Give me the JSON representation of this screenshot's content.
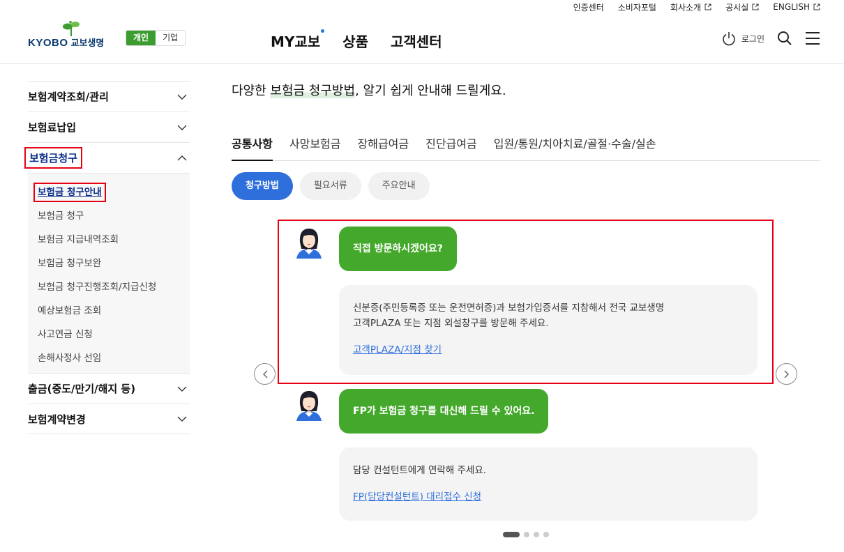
{
  "util_links": [
    {
      "label": "인증센터",
      "external": false
    },
    {
      "label": "소비자포털",
      "external": false
    },
    {
      "label": "회사소개",
      "external": true
    },
    {
      "label": "공시실",
      "external": true
    },
    {
      "label": "ENGLISH",
      "external": true
    }
  ],
  "brand": {
    "logo_en": "KYOBO",
    "logo_kr": "교보생명",
    "accent": "#3c9c30"
  },
  "segment": {
    "personal": "개인",
    "corporate": "기업",
    "selected": "개인"
  },
  "gnb": [
    "MY교보",
    "상품",
    "고객센터"
  ],
  "header_right": {
    "login": "로그인"
  },
  "sidebar": {
    "items": [
      {
        "label": "보험계약조회/관리",
        "expanded": false
      },
      {
        "label": "보험료납입",
        "expanded": false
      },
      {
        "label": "보험금청구",
        "expanded": true
      },
      {
        "label": "출금(중도/만기/해지 등)",
        "expanded": false
      },
      {
        "label": "보험계약변경",
        "expanded": false
      }
    ],
    "sub_items": [
      "보험금 청구안내",
      "보험금 청구",
      "보험금 지급내역조회",
      "보험금 청구보완",
      "보험금 청구진행조회/지급신청",
      "예상보험금 조회",
      "사고연금 신청",
      "손해사정사 선임"
    ]
  },
  "main": {
    "subtitle_pre": "다양한 ",
    "subtitle_hl": "보험금 청구방법",
    "subtitle_post": ", 알기 쉽게 안내해 드릴게요.",
    "tabs": [
      "공통사항",
      "사망보험금",
      "장해급여금",
      "진단급여금",
      "입원/통원/치아치료/골절·수술/실손"
    ],
    "pills": [
      "청구방법",
      "필요서류",
      "주요안내"
    ],
    "cards": [
      {
        "question": "직접 방문하시겠어요?",
        "answer_line1": "신분증(주민등록증 또는 운전면허증)과 보험가입증서를 지참해서 전국 교보생명",
        "answer_line2": "고객PLAZA 또는 지점 외설창구를 방문해 주세요.",
        "link": "고객PLAZA/지점 찾기"
      },
      {
        "question": "FP가 보험금 청구를 대신해 드릴 수 있어요.",
        "answer_line1": "담당 컨설턴트에게 연락해 주세요.",
        "link": "FP(담당컨설턴트) 대리접수 신청"
      }
    ],
    "carousel_pages": 4,
    "carousel_current": 1
  }
}
